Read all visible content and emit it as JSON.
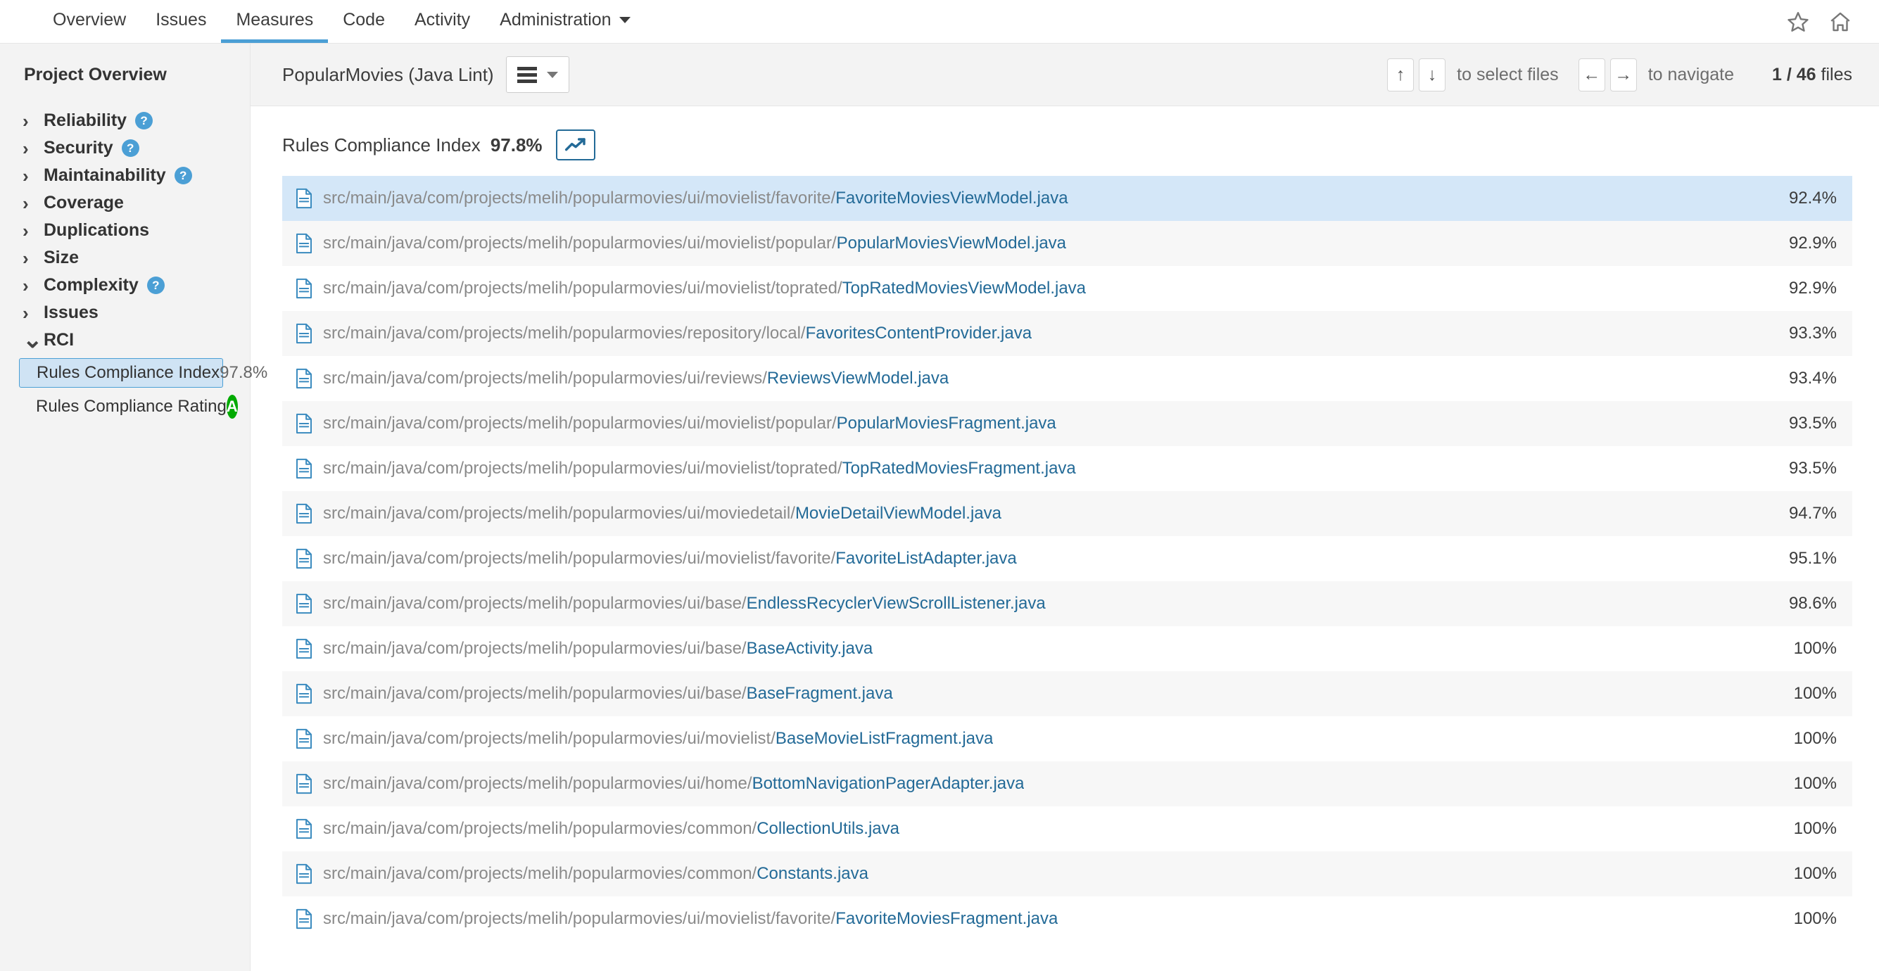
{
  "topnav": {
    "items": [
      {
        "label": "Overview",
        "active": false
      },
      {
        "label": "Issues",
        "active": false
      },
      {
        "label": "Measures",
        "active": true
      },
      {
        "label": "Code",
        "active": false
      },
      {
        "label": "Activity",
        "active": false
      },
      {
        "label": "Administration",
        "active": false,
        "has_caret": true
      }
    ],
    "favorite_icon": "star-icon",
    "home_icon": "home-icon"
  },
  "sidebar": {
    "title": "Project Overview",
    "domains": [
      {
        "label": "Reliability",
        "expanded": false,
        "help": true
      },
      {
        "label": "Security",
        "expanded": false,
        "help": true
      },
      {
        "label": "Maintainability",
        "expanded": false,
        "help": true
      },
      {
        "label": "Coverage",
        "expanded": false,
        "help": false
      },
      {
        "label": "Duplications",
        "expanded": false,
        "help": false
      },
      {
        "label": "Size",
        "expanded": false,
        "help": false
      },
      {
        "label": "Complexity",
        "expanded": false,
        "help": true
      },
      {
        "label": "Issues",
        "expanded": false,
        "help": false
      },
      {
        "label": "RCI",
        "expanded": true,
        "help": false
      }
    ],
    "measures": [
      {
        "name": "Rules Compliance Index",
        "value": "97.8%",
        "selected": true,
        "rating": null
      },
      {
        "name": "Rules Compliance Rating",
        "value": null,
        "selected": false,
        "rating": "A",
        "rating_color": "#00aa00"
      }
    ]
  },
  "main": {
    "project_name": "PopularMovies (Java Lint)",
    "view_toggle_icon": "list-view-icon",
    "select_hint": "to select files",
    "navigate_hint": "to navigate",
    "key_up": "↑",
    "key_down": "↓",
    "key_left": "←",
    "key_right": "→",
    "files_current": "1",
    "files_total": "46",
    "files_label": "files",
    "files_count_text": "1 / 46 files",
    "measure_title": "Rules Compliance Index",
    "measure_value": "97.8%",
    "trend_icon": "trend-chart-icon"
  },
  "files": [
    {
      "path": "src/main/java/com/projects/melih/popularmovies/ui/movielist/favorite/",
      "name": "FavoriteMoviesViewModel.java",
      "value": "92.4%",
      "selected": true
    },
    {
      "path": "src/main/java/com/projects/melih/popularmovies/ui/movielist/popular/",
      "name": "PopularMoviesViewModel.java",
      "value": "92.9%",
      "selected": false
    },
    {
      "path": "src/main/java/com/projects/melih/popularmovies/ui/movielist/toprated/",
      "name": "TopRatedMoviesViewModel.java",
      "value": "92.9%",
      "selected": false
    },
    {
      "path": "src/main/java/com/projects/melih/popularmovies/repository/local/",
      "name": "FavoritesContentProvider.java",
      "value": "93.3%",
      "selected": false
    },
    {
      "path": "src/main/java/com/projects/melih/popularmovies/ui/reviews/",
      "name": "ReviewsViewModel.java",
      "value": "93.4%",
      "selected": false
    },
    {
      "path": "src/main/java/com/projects/melih/popularmovies/ui/movielist/popular/",
      "name": "PopularMoviesFragment.java",
      "value": "93.5%",
      "selected": false
    },
    {
      "path": "src/main/java/com/projects/melih/popularmovies/ui/movielist/toprated/",
      "name": "TopRatedMoviesFragment.java",
      "value": "93.5%",
      "selected": false
    },
    {
      "path": "src/main/java/com/projects/melih/popularmovies/ui/moviedetail/",
      "name": "MovieDetailViewModel.java",
      "value": "94.7%",
      "selected": false
    },
    {
      "path": "src/main/java/com/projects/melih/popularmovies/ui/movielist/favorite/",
      "name": "FavoriteListAdapter.java",
      "value": "95.1%",
      "selected": false
    },
    {
      "path": "src/main/java/com/projects/melih/popularmovies/ui/base/",
      "name": "EndlessRecyclerViewScrollListener.java",
      "value": "98.6%",
      "selected": false
    },
    {
      "path": "src/main/java/com/projects/melih/popularmovies/ui/base/",
      "name": "BaseActivity.java",
      "value": "100%",
      "selected": false
    },
    {
      "path": "src/main/java/com/projects/melih/popularmovies/ui/base/",
      "name": "BaseFragment.java",
      "value": "100%",
      "selected": false
    },
    {
      "path": "src/main/java/com/projects/melih/popularmovies/ui/movielist/",
      "name": "BaseMovieListFragment.java",
      "value": "100%",
      "selected": false
    },
    {
      "path": "src/main/java/com/projects/melih/popularmovies/ui/home/",
      "name": "BottomNavigationPagerAdapter.java",
      "value": "100%",
      "selected": false
    },
    {
      "path": "src/main/java/com/projects/melih/popularmovies/common/",
      "name": "CollectionUtils.java",
      "value": "100%",
      "selected": false
    },
    {
      "path": "src/main/java/com/projects/melih/popularmovies/common/",
      "name": "Constants.java",
      "value": "100%",
      "selected": false
    },
    {
      "path": "src/main/java/com/projects/melih/popularmovies/ui/movielist/favorite/",
      "name": "FavoriteMoviesFragment.java",
      "value": "100%",
      "selected": false
    }
  ],
  "colors": {
    "accent_blue": "#4b9fd5",
    "link_blue": "#236a97",
    "selected_row": "#d4e7f8",
    "rating_a_green": "#00aa00"
  }
}
